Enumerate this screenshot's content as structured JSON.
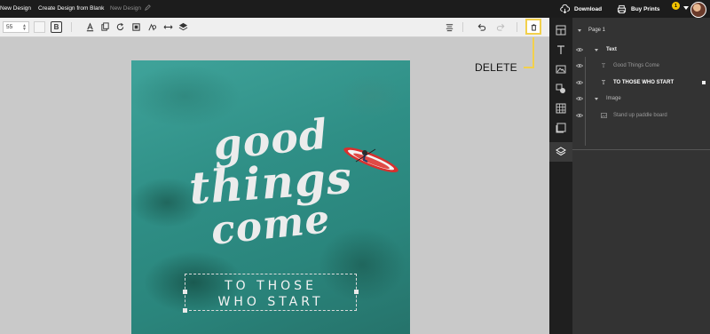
{
  "topbar": {
    "new_design": "New Design",
    "create_blank": "Create Design from Blank",
    "doc_name": "New Design",
    "download": "Download",
    "buy_prints": "Buy Prints",
    "badge_count": "1"
  },
  "toolbar": {
    "font_size": "55",
    "bold_label": "B"
  },
  "callout": {
    "label": "DELETE"
  },
  "design": {
    "script_lines": [
      "good",
      "things",
      "come"
    ],
    "tagline": "TO THOSE\nWHO START"
  },
  "layers": {
    "page": "Page 1",
    "text_group": "Text",
    "text_items": [
      "Good Things Come",
      "TO THOSE WHO START"
    ],
    "image_group": "Image",
    "image_items": [
      "Stand up paddle board"
    ]
  },
  "colors": {
    "accent_highlight": "#f2d04c",
    "topbar_bg": "#1c1c1c",
    "panel_bg": "#333333"
  },
  "icons": [
    "cloud-download-icon",
    "printer-icon",
    "pencil-icon",
    "trash-icon",
    "undo-icon",
    "redo-icon",
    "layers-icon",
    "eye-icon",
    "text-icon",
    "image-icon"
  ]
}
